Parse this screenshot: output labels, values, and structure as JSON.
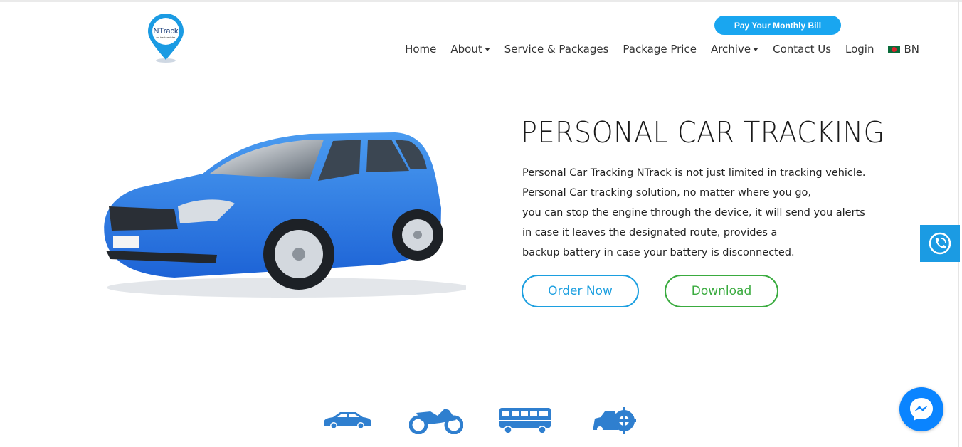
{
  "header": {
    "logo_text": "NTrack",
    "logo_tagline": "we track vehicles",
    "pay_button_label": "Pay Your Monthly Bill",
    "nav": [
      {
        "label": "Home",
        "dropdown": false
      },
      {
        "label": "About",
        "dropdown": true
      },
      {
        "label": "Service & Packages",
        "dropdown": false
      },
      {
        "label": "Package Price",
        "dropdown": false
      },
      {
        "label": "Archive",
        "dropdown": true
      },
      {
        "label": "Contact Us",
        "dropdown": false
      },
      {
        "label": "Login",
        "dropdown": false
      }
    ],
    "language": {
      "label": "BN",
      "flag_icon": "bangladesh-flag-icon"
    }
  },
  "hero": {
    "title": "PERSONAL CAR TRACKING",
    "description_lines": [
      "Personal Car Tracking NTrack is not just limited in tracking vehicle.",
      "Personal Car tracking solution, no matter where you go,",
      "you can stop the engine through the device, it will send you alerts",
      "in case it leaves the designated route, provides a",
      "backup battery in case your battery is disconnected."
    ],
    "order_button_label": "Order Now",
    "download_button_label": "Download",
    "image_icon": "blue-car-illustration"
  },
  "vehicle_icons": [
    "car-icon",
    "motorcycle-icon",
    "bus-icon",
    "car-engine-icon"
  ],
  "widgets": {
    "call_icon": "phone-call-icon",
    "chat_icon": "messenger-icon"
  },
  "colors": {
    "primary_blue": "#19a6f0",
    "order_blue": "#1c9fe0",
    "download_green": "#3aab3f",
    "icon_blue": "#2f7fcf",
    "messenger_blue": "#0a84ff"
  }
}
